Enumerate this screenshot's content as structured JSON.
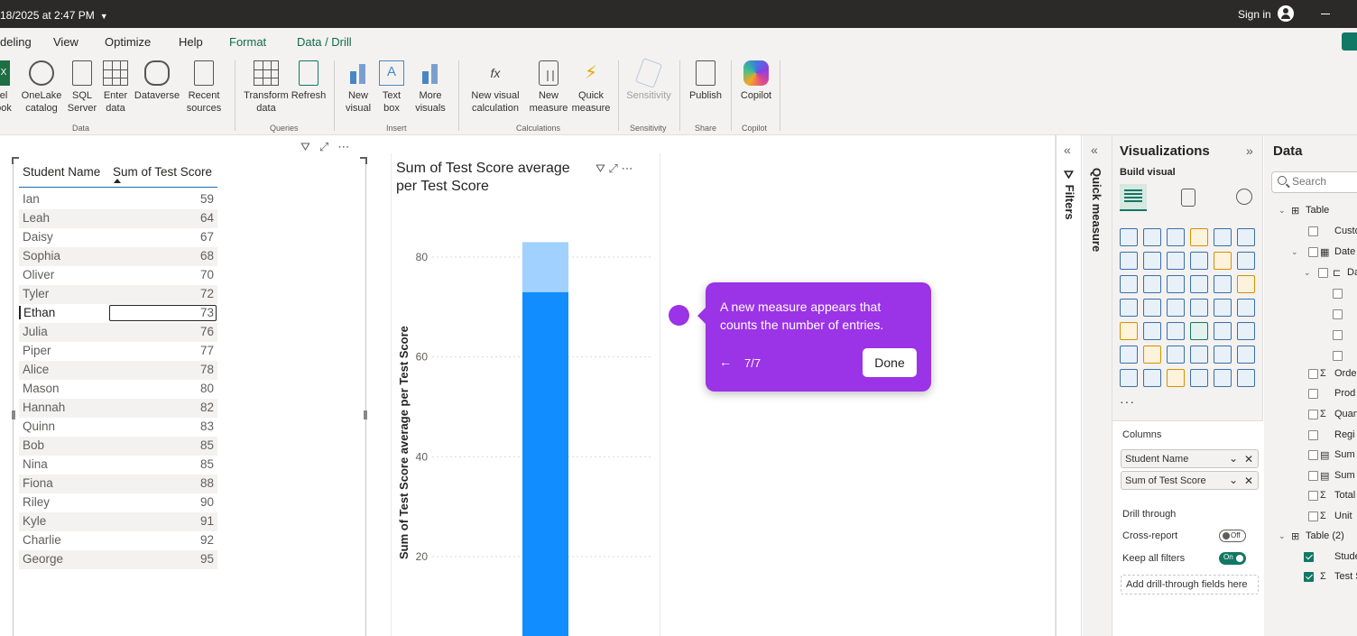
{
  "titlebar": {
    "saved_text": "18/2025 at 2:47 PM",
    "sign_in": "Sign in"
  },
  "menu": {
    "tabs": [
      "deling",
      "View",
      "Optimize",
      "Help",
      "Format",
      "Data / Drill"
    ]
  },
  "ribbon": {
    "groups": {
      "data": "Data",
      "queries": "Queries",
      "insert": "Insert",
      "calculations": "Calculations",
      "sensitivity": "Sensitivity",
      "share": "Share",
      "copilot": "Copilot"
    },
    "buttons": {
      "excel": "el\nook",
      "onelake": "OneLake\ncatalog",
      "sql": "SQL\nServer",
      "enter_data": "Enter\ndata",
      "dataverse": "Dataverse",
      "recent": "Recent\nsources",
      "transform": "Transform\ndata",
      "refresh": "Refresh",
      "new_visual": "New\nvisual",
      "text_box": "Text\nbox",
      "more_visuals": "More\nvisuals",
      "new_visual_calc": "New visual\ncalculation",
      "new_measure": "New\nmeasure",
      "quick_measure": "Quick\nmeasure",
      "sensitivity": "Sensitivity",
      "publish": "Publish",
      "copilot": "Copilot"
    }
  },
  "table_visual": {
    "headers": [
      "Student Name",
      "Sum of Test Score"
    ],
    "rows": [
      {
        "name": "Ian",
        "score": "59"
      },
      {
        "name": "Leah",
        "score": "64"
      },
      {
        "name": "Daisy",
        "score": "67"
      },
      {
        "name": "Sophia",
        "score": "68"
      },
      {
        "name": "Oliver",
        "score": "70"
      },
      {
        "name": "Tyler",
        "score": "72"
      },
      {
        "name": "Ethan",
        "score": "73"
      },
      {
        "name": "Julia",
        "score": "76"
      },
      {
        "name": "Piper",
        "score": "77"
      },
      {
        "name": "Alice",
        "score": "78"
      },
      {
        "name": "Mason",
        "score": "80"
      },
      {
        "name": "Hannah",
        "score": "82"
      },
      {
        "name": "Quinn",
        "score": "83"
      },
      {
        "name": "Bob",
        "score": "85"
      },
      {
        "name": "Nina",
        "score": "85"
      },
      {
        "name": "Fiona",
        "score": "88"
      },
      {
        "name": "Riley",
        "score": "90"
      },
      {
        "name": "Kyle",
        "score": "91"
      },
      {
        "name": "Charlie",
        "score": "92"
      },
      {
        "name": "George",
        "score": "95"
      }
    ]
  },
  "chart_data": {
    "type": "bar",
    "title": "Sum of Test Score average per Test Score",
    "ylabel": "Sum of Test Score average per Test Score",
    "xlabel": "",
    "yticks": [
      20,
      40,
      60,
      80
    ],
    "ylim": [
      0,
      100
    ],
    "stacked": true,
    "segments": [
      {
        "value": 73,
        "color": "#118dff"
      },
      {
        "value": 10,
        "color": "#a0d1ff"
      }
    ]
  },
  "guide": {
    "message": "A new measure appears that counts the number of entries.",
    "back_arrow": "←",
    "step": "7/7",
    "done_label": "Done"
  },
  "panes": {
    "filters": "Filters",
    "quick_measure": "Quick measure",
    "visualizations_title": "Visualizations",
    "build_visual": "Build visual",
    "more": "···",
    "columns_label": "Columns",
    "column_fields": [
      "Student Name",
      "Sum of Test Score"
    ],
    "drill_through": "Drill through",
    "cross_report": "Cross-report",
    "cross_report_state": "Off",
    "keep_all_filters": "Keep all filters",
    "keep_all_filters_state": "On",
    "add_drill_fields": "Add drill-through fields here"
  },
  "data_pane": {
    "title": "Data",
    "search_placeholder": "Search",
    "table1": "Table",
    "table1_fields": [
      "Custo",
      "Date",
      "Da",
      "",
      "",
      "",
      "",
      "Orde",
      "Prod",
      "Quan",
      "Regi",
      "Sum",
      "Sum",
      "Total",
      "Unit"
    ],
    "table2": "Table (2)",
    "table2_fields": [
      "Stude",
      "Test S"
    ]
  },
  "colors": {
    "accent": "#117865",
    "guide_purple": "#9b33e6",
    "bar_main": "#118dff",
    "bar_light": "#a0d1ff"
  }
}
